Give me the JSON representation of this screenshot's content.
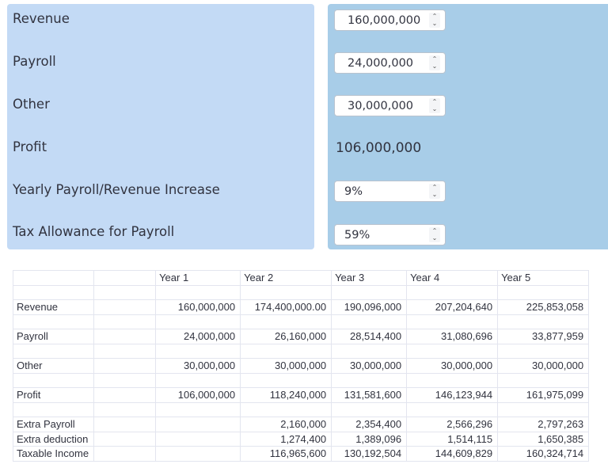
{
  "inputs": {
    "revenue": {
      "label": "Revenue",
      "value": "160,000,000"
    },
    "payroll": {
      "label": "Payroll",
      "value": "24,000,000"
    },
    "other": {
      "label": "Other",
      "value": "30,000,000"
    },
    "profit": {
      "label": "Profit",
      "value": "106,000,000"
    },
    "increase": {
      "label": "Yearly Payroll/Revenue Increase",
      "value": "9%"
    },
    "allowance": {
      "label": "Tax Allowance for Payroll",
      "value": "59%"
    }
  },
  "spinner": {
    "up": "⌃",
    "down": "⌄"
  },
  "table": {
    "headers": [
      "",
      "",
      "Year 1",
      "Year 2",
      "Year 3",
      "Year 4",
      "Year 5"
    ],
    "rows": [
      {
        "label": ""
      },
      {
        "label": "Revenue",
        "values": [
          "160,000,000",
          "174,400,000.00",
          "190,096,000",
          "207,204,640",
          "225,853,058"
        ]
      },
      {
        "label": ""
      },
      {
        "label": "Payroll",
        "values": [
          "24,000,000",
          "26,160,000",
          "28,514,400",
          "31,080,696",
          "33,877,959"
        ]
      },
      {
        "label": ""
      },
      {
        "label": "Other",
        "values": [
          "30,000,000",
          "30,000,000",
          "30,000,000",
          "30,000,000",
          "30,000,000"
        ]
      },
      {
        "label": ""
      },
      {
        "label": "Profit",
        "values": [
          "106,000,000",
          "118,240,000",
          "131,581,600",
          "146,123,944",
          "161,975,099"
        ]
      },
      {
        "label": ""
      },
      {
        "label": "Extra Payroll",
        "values": [
          "",
          "2,160,000",
          "2,354,400",
          "2,566,296",
          "2,797,263"
        ]
      },
      {
        "label": "Extra deduction",
        "values": [
          "",
          "1,274,400",
          "1,389,096",
          "1,514,115",
          "1,650,385"
        ]
      },
      {
        "label": "Taxable Income",
        "values": [
          "",
          "116,965,600",
          "130,192,504",
          "144,609,829",
          "160,324,714"
        ]
      }
    ]
  }
}
